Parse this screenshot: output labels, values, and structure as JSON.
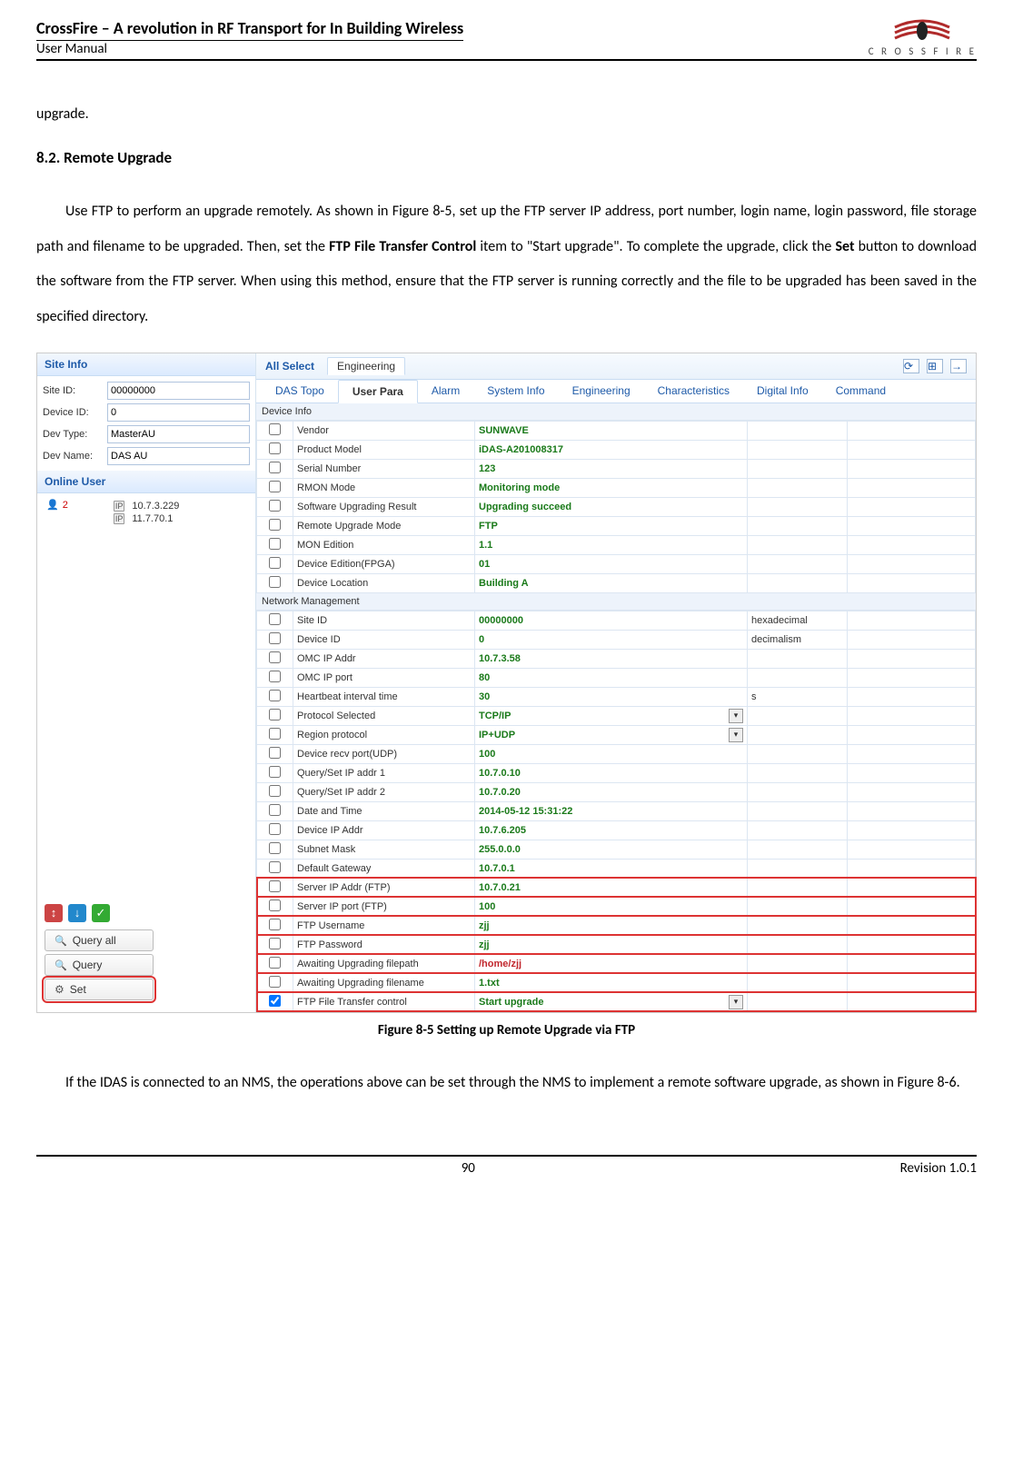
{
  "header": {
    "title": "CrossFire – A revolution in RF Transport for In Building Wireless",
    "subtitle": "User Manual",
    "logo_text": "C R O S S F I R E"
  },
  "body": {
    "pre_text": "upgrade.",
    "section_heading": "8.2. Remote Upgrade",
    "p1_a": "Use FTP to perform an upgrade remotely. As shown in Figure 8-5, set up the FTP server IP address, port number, login name, login password, file storage path and filename to be upgraded. Then, set the ",
    "p1_bold1": "FTP File Transfer Control",
    "p1_b": " item to \"Start upgrade\". To complete the upgrade, click the ",
    "p1_bold2": "Set",
    "p1_c": " button to download the software from the FTP server. When using this method, ensure that the FTP server is running correctly and the file to be upgraded has been saved in the specified directory.",
    "caption": "Figure 8-5 Setting up Remote Upgrade via FTP",
    "p2": "If the IDAS is connected to an NMS, the operations above can be set through the NMS to implement a remote software upgrade, as shown in Figure 8-6."
  },
  "footer": {
    "page": "90",
    "revision": "Revision 1.0.1"
  },
  "ss": {
    "site_info_title": "Site Info",
    "site_id_label": "Site ID:",
    "site_id": "00000000",
    "device_id_label": "Device ID:",
    "device_id": "0",
    "dev_type_label": "Dev Type:",
    "dev_type": "MasterAU",
    "dev_name_label": "Dev Name:",
    "dev_name": "DAS AU",
    "online_title": "Online User",
    "online_count": "2",
    "ip1": "10.7.3.229",
    "ip2": "11.7.70.1",
    "btn_query_all": "Query all",
    "btn_query": "Query",
    "btn_set": "Set",
    "top_all": "All Select",
    "top_tab": "Engineering",
    "tabs": [
      "DAS Topo",
      "User Para",
      "Alarm",
      "System Info",
      "Engineering",
      "Characteristics",
      "Digital Info",
      "Command"
    ],
    "grp_device": "Device Info",
    "device_rows": [
      {
        "name": "Vendor",
        "val": "SUNWAVE",
        "cls": "val-green"
      },
      {
        "name": "Product Model",
        "val": "iDAS-A201008317",
        "cls": "val-green"
      },
      {
        "name": "Serial Number",
        "val": "123",
        "cls": "val-green"
      },
      {
        "name": "RMON Mode",
        "val": "Monitoring mode",
        "cls": "val-green"
      },
      {
        "name": "Software Upgrading Result",
        "val": "Upgrading succeed",
        "cls": "val-green"
      },
      {
        "name": "Remote Upgrade Mode",
        "val": "FTP",
        "cls": "val-green"
      },
      {
        "name": "MON Edition",
        "val": "1.1",
        "cls": "val-green"
      },
      {
        "name": "Device Edition(FPGA)",
        "val": "01",
        "cls": "val-green"
      },
      {
        "name": "Device Location",
        "val": "Building A",
        "cls": "val-green"
      }
    ],
    "grp_network": "Network Management",
    "network_rows": [
      {
        "name": "Site ID",
        "val": "00000000",
        "unit": "hexadecimal",
        "cls": "val-green"
      },
      {
        "name": "Device ID",
        "val": "0",
        "unit": "decimalism",
        "cls": "val-green"
      },
      {
        "name": "OMC IP Addr",
        "val": "10.7.3.58",
        "cls": "val-green"
      },
      {
        "name": "OMC IP port",
        "val": "80",
        "cls": "val-green"
      },
      {
        "name": "Heartbeat interval time",
        "val": "30",
        "unit": "s",
        "cls": "val-green"
      },
      {
        "name": "Protocol Selected",
        "val": "TCP/IP",
        "cls": "val-green",
        "sel": true
      },
      {
        "name": "Region protocol",
        "val": "IP+UDP",
        "cls": "val-green",
        "sel": true
      },
      {
        "name": "Device recv port(UDP)",
        "val": "100",
        "cls": "val-green"
      },
      {
        "name": "Query/Set IP addr 1",
        "val": "10.7.0.10",
        "cls": "val-green"
      },
      {
        "name": "Query/Set IP addr 2",
        "val": "10.7.0.20",
        "cls": "val-green"
      },
      {
        "name": "Date and Time",
        "val": "2014-05-12 15:31:22",
        "cls": "val-green"
      },
      {
        "name": "Device IP Addr",
        "val": "10.7.6.205",
        "cls": "val-green"
      },
      {
        "name": "Subnet Mask",
        "val": "255.0.0.0",
        "cls": "val-green"
      },
      {
        "name": "Default Gateway",
        "val": "10.7.0.1",
        "cls": "val-green"
      },
      {
        "name": "Server IP Addr (FTP)",
        "val": "10.7.0.21",
        "cls": "val-green",
        "ftp": true
      },
      {
        "name": "Server IP port (FTP)",
        "val": "100",
        "cls": "val-green",
        "ftp": true
      },
      {
        "name": "FTP Username",
        "val": "zjj",
        "cls": "val-green",
        "ftp": true
      },
      {
        "name": "FTP Password",
        "val": "zjj",
        "cls": "val-green",
        "ftp": true
      },
      {
        "name": "Awaiting Upgrading filepath",
        "val": "/home/zjj",
        "cls": "val-red",
        "ftp": true
      },
      {
        "name": "Awaiting Upgrading filename",
        "val": "1.txt",
        "cls": "val-green",
        "ftp": true
      },
      {
        "name": "FTP File Transfer control",
        "val": "Start upgrade",
        "cls": "val-green",
        "sel": true,
        "checked": true,
        "ftp_last": true
      }
    ]
  }
}
